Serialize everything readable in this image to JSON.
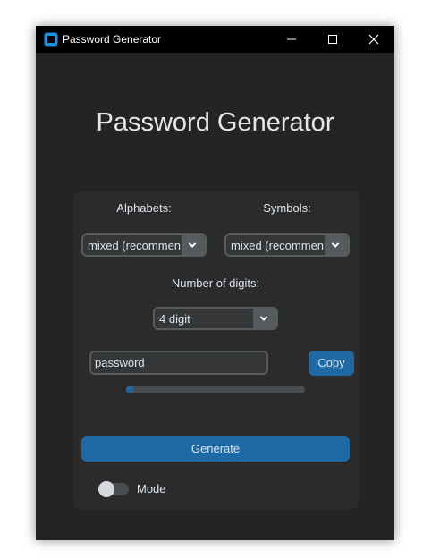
{
  "window": {
    "title": "Password Generator",
    "controls": [
      "minimize-icon",
      "maximize-icon",
      "close-icon"
    ]
  },
  "heading": "Password Generator",
  "alphabets": {
    "label": "Alphabets:",
    "selected": "mixed (recommended)"
  },
  "symbols": {
    "label": "Symbols:",
    "selected": "mixed (recommended)"
  },
  "digits": {
    "label": "Number of digits:",
    "selected": "4 digit"
  },
  "password_field": {
    "value": "password"
  },
  "copy_label": "Copy",
  "strength_progress": 0.04,
  "generate_label": "Generate",
  "mode": {
    "label": "Mode",
    "on": false
  },
  "colors": {
    "window_bg": "#242424",
    "panel_bg": "#2b2b2b",
    "accent": "#1f6aa5",
    "input_bg": "#343638",
    "border": "#565b5e",
    "text": "#dce4ee"
  }
}
